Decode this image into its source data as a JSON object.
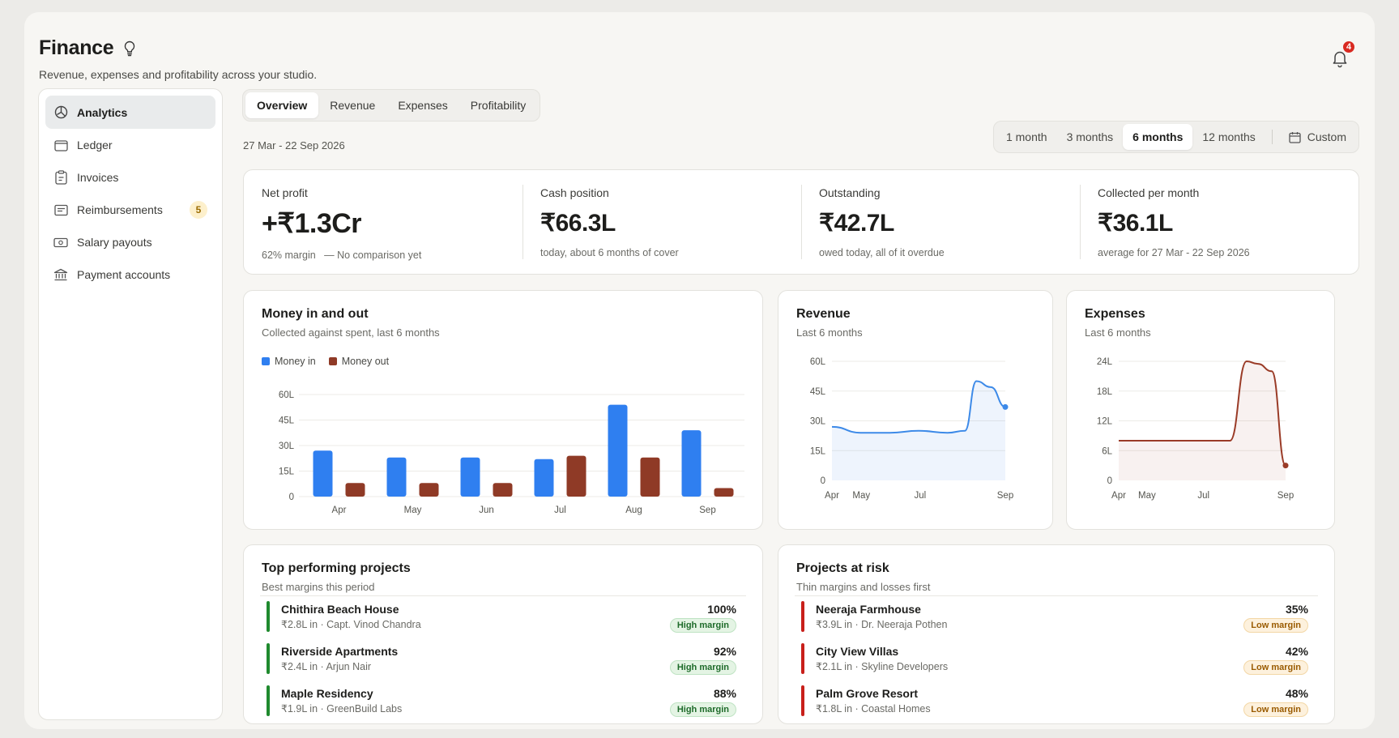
{
  "header": {
    "title": "Finance",
    "subtitle": "Revenue, expenses and profitability across your studio.",
    "notifications": "4"
  },
  "sidebar": {
    "items": [
      {
        "label": "Analytics",
        "icon": "chart-pie-icon",
        "active": true
      },
      {
        "label": "Ledger",
        "icon": "wallet-icon"
      },
      {
        "label": "Invoices",
        "icon": "clipboard-icon"
      },
      {
        "label": "Reimbursements",
        "icon": "receipt-icon",
        "badge": "5"
      },
      {
        "label": "Salary payouts",
        "icon": "banknote-icon"
      },
      {
        "label": "Payment accounts",
        "icon": "bank-icon"
      }
    ]
  },
  "tabs": [
    "Overview",
    "Revenue",
    "Expenses",
    "Profitability"
  ],
  "active_tab": "Overview",
  "date_range": "27 Mar - 22 Sep 2026",
  "periods": [
    "1 month",
    "3 months",
    "6 months",
    "12 months"
  ],
  "active_period": "6 months",
  "custom_label": "Custom",
  "kpis": [
    {
      "label": "Net profit",
      "value": "+₹1.3Cr",
      "sub_a": "62% margin",
      "sub_b": "— No comparison yet"
    },
    {
      "label": "Cash position",
      "value": "₹66.3L",
      "sub": "today, about 6 months of cover"
    },
    {
      "label": "Outstanding",
      "value": "₹42.7L",
      "sub": "owed today, all of it overdue"
    },
    {
      "label": "Collected per month",
      "value": "₹36.1L",
      "sub": "average for 27 Mar - 22 Sep 2026"
    }
  ],
  "colors": {
    "money_in": "#2f7ff0",
    "money_out": "#8f3a26",
    "revenue": "#3d8ae8",
    "expenses": "#9a3b27",
    "high": "#1f8a2e",
    "low": "#c8201b"
  },
  "chart_data": [
    {
      "type": "bar",
      "title": "Money in and out",
      "subtitle": "Collected against spent, last 6 months",
      "categories": [
        "Apr",
        "May",
        "Jun",
        "Jul",
        "Aug",
        "Sep"
      ],
      "series": [
        {
          "name": "Money in",
          "values": [
            27,
            23,
            23,
            22,
            54,
            39
          ]
        },
        {
          "name": "Money out",
          "values": [
            8,
            8,
            8,
            24,
            23,
            5
          ]
        }
      ],
      "yticks": [
        "0",
        "15L",
        "30L",
        "45L",
        "60L"
      ],
      "ylim": [
        0,
        60
      ],
      "legend": "top-left",
      "grid": true
    },
    {
      "type": "area",
      "title": "Revenue",
      "subtitle": "Last 6 months",
      "xticks": [
        "Apr",
        "May",
        "Jul",
        "Sep"
      ],
      "x": [
        0,
        1,
        2,
        3,
        4,
        4.6,
        5,
        5.5,
        6
      ],
      "values": [
        27,
        24,
        24,
        25,
        24,
        25,
        50,
        47,
        37
      ],
      "yticks": [
        "0",
        "15L",
        "30L",
        "45L",
        "60L"
      ],
      "ylim": [
        0,
        60
      ],
      "grid": true
    },
    {
      "type": "area",
      "title": "Expenses",
      "subtitle": "Last 6 months",
      "xticks": [
        "Apr",
        "May",
        "Jul",
        "Sep"
      ],
      "x": [
        0,
        1,
        2,
        3,
        4,
        4.6,
        5,
        5.5,
        6
      ],
      "values": [
        8,
        8,
        8,
        8,
        8,
        24,
        23.5,
        22,
        3
      ],
      "yticks": [
        "0",
        "6L",
        "12L",
        "18L",
        "24L"
      ],
      "ylim": [
        0,
        24
      ],
      "grid": true
    }
  ],
  "top_projects": {
    "title": "Top performing projects",
    "subtitle": "Best margins this period",
    "rows": [
      {
        "name": "Chithira Beach House",
        "meta": "₹2.8L in · Capt. Vinod Chandra",
        "pct": "100%",
        "pill": "High margin"
      },
      {
        "name": "Riverside Apartments",
        "meta": "₹2.4L in · Arjun Nair",
        "pct": "92%",
        "pill": "High margin"
      },
      {
        "name": "Maple Residency",
        "meta": "₹1.9L in · GreenBuild Labs",
        "pct": "88%",
        "pill": "High margin"
      }
    ]
  },
  "risk_projects": {
    "title": "Projects at risk",
    "subtitle": "Thin margins and losses first",
    "rows": [
      {
        "name": "Neeraja Farmhouse",
        "meta": "₹3.9L in · Dr. Neeraja Pothen",
        "pct": "35%",
        "pill": "Low margin"
      },
      {
        "name": "City View Villas",
        "meta": "₹2.1L in · Skyline Developers",
        "pct": "42%",
        "pill": "Low margin"
      },
      {
        "name": "Palm Grove Resort",
        "meta": "₹1.8L in · Coastal Homes",
        "pct": "48%",
        "pill": "Low margin"
      }
    ]
  }
}
